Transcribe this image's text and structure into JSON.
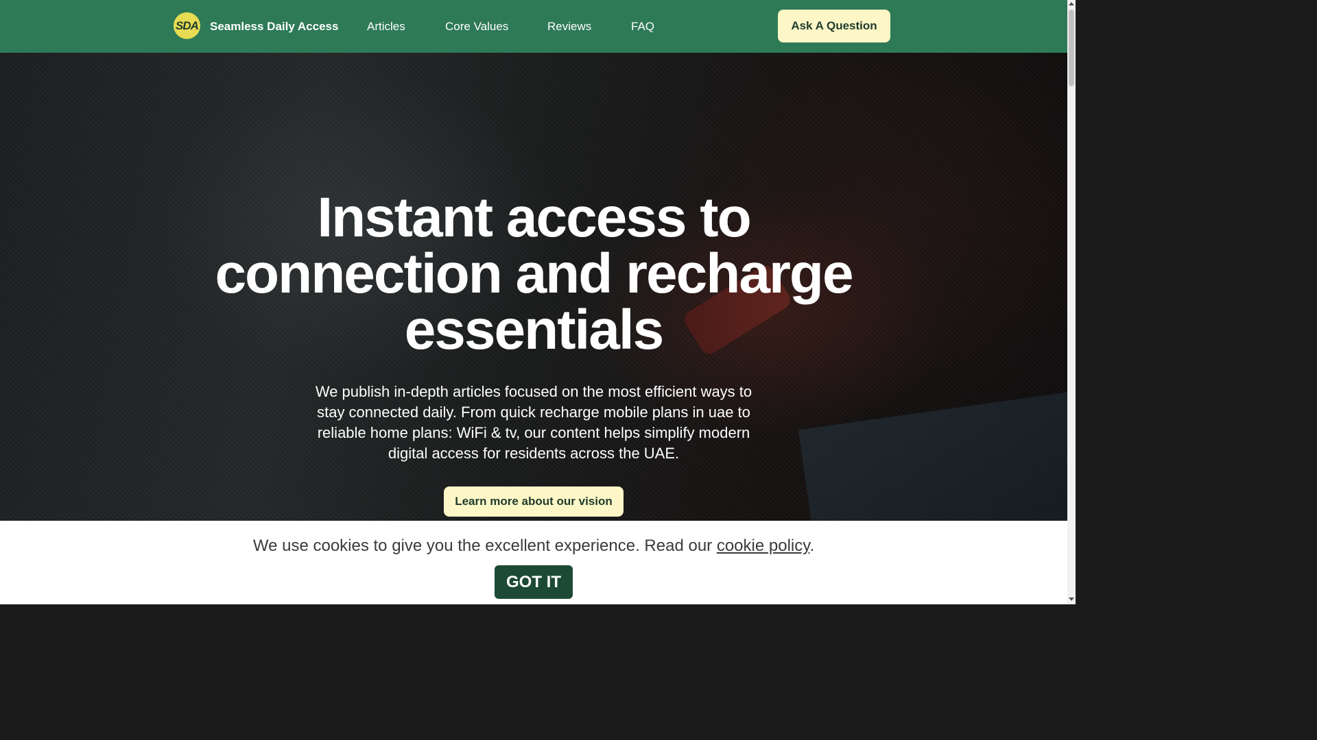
{
  "header": {
    "logo_text": "SDA",
    "brand": "Seamless Daily Access",
    "nav": [
      "Articles",
      "Core Values",
      "Reviews",
      "FAQ"
    ],
    "cta": "Ask A Question"
  },
  "hero": {
    "title_lines": [
      "Instant access to",
      "connection and recharge",
      "essentials"
    ],
    "description": "We publish in-depth articles focused on the most efficient ways to stay connected daily. From quick recharge mobile plans in uae to reliable home plans: WiFi & tv, our content helps simplify modern digital access for residents across the UAE.",
    "button": "Learn more about our vision"
  },
  "cookie": {
    "text_before": "We use cookies to give you the excellent experience. Read our ",
    "link": "cookie policy",
    "text_after": ".",
    "button": "GOT IT"
  },
  "colors": {
    "header_bg": "#2e7a57",
    "accent_button": "#fdf6c6",
    "cookie_button": "#1d4a35",
    "logo_badge": "#e6db52"
  }
}
